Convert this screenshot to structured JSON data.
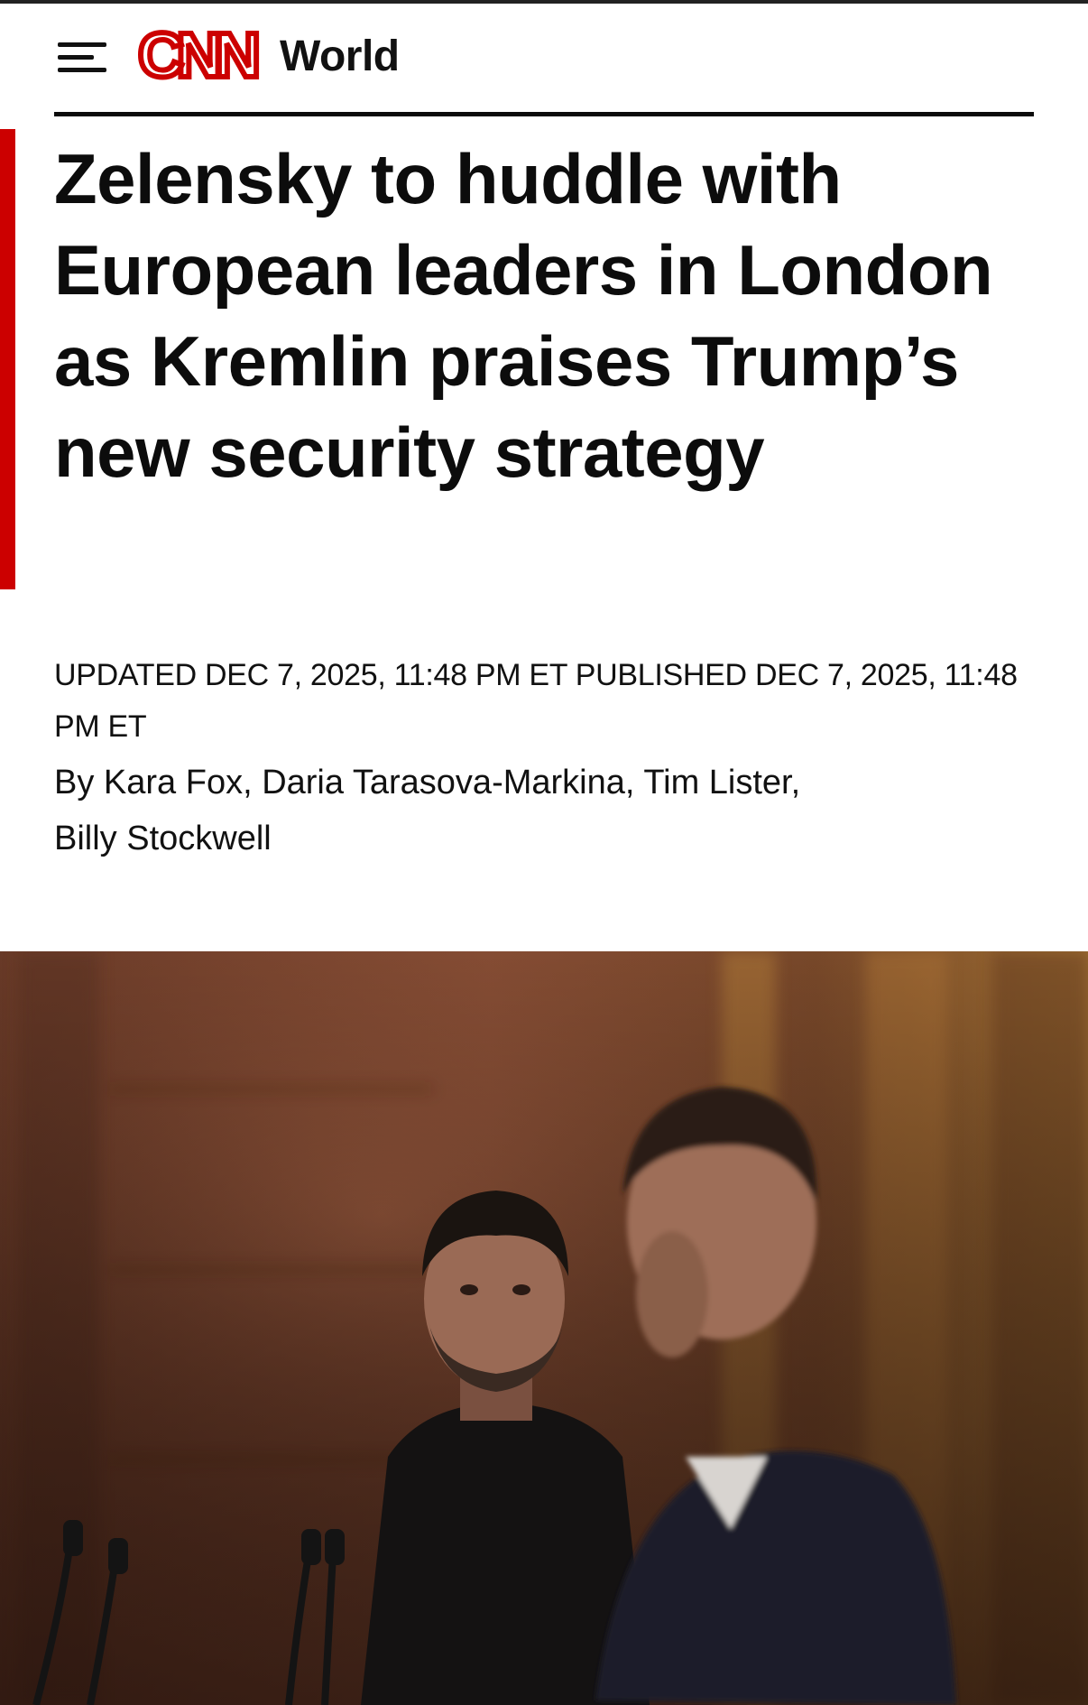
{
  "header": {
    "brand": "CNN",
    "section": "World"
  },
  "article": {
    "headline": "Zelensky to huddle with European leaders in London as Kremlin praises Trump’s new security strategy",
    "timestamp": "UPDATED DEC 7, 2025, 11:48 PM ET PUBLISHED DEC 7, 2025, 11:48 PM ET",
    "byline": {
      "prefix": "By ",
      "authors": [
        "Kara Fox",
        "Daria Tarasova-Markina",
        "Tim Lister",
        "Billy Stockwell"
      ],
      "separator": ", "
    }
  },
  "colors": {
    "brand_red": "#cc0000",
    "text": "#111111"
  },
  "icons": {
    "menu": "hamburger-menu-icon",
    "logo": "cnn-logo"
  }
}
